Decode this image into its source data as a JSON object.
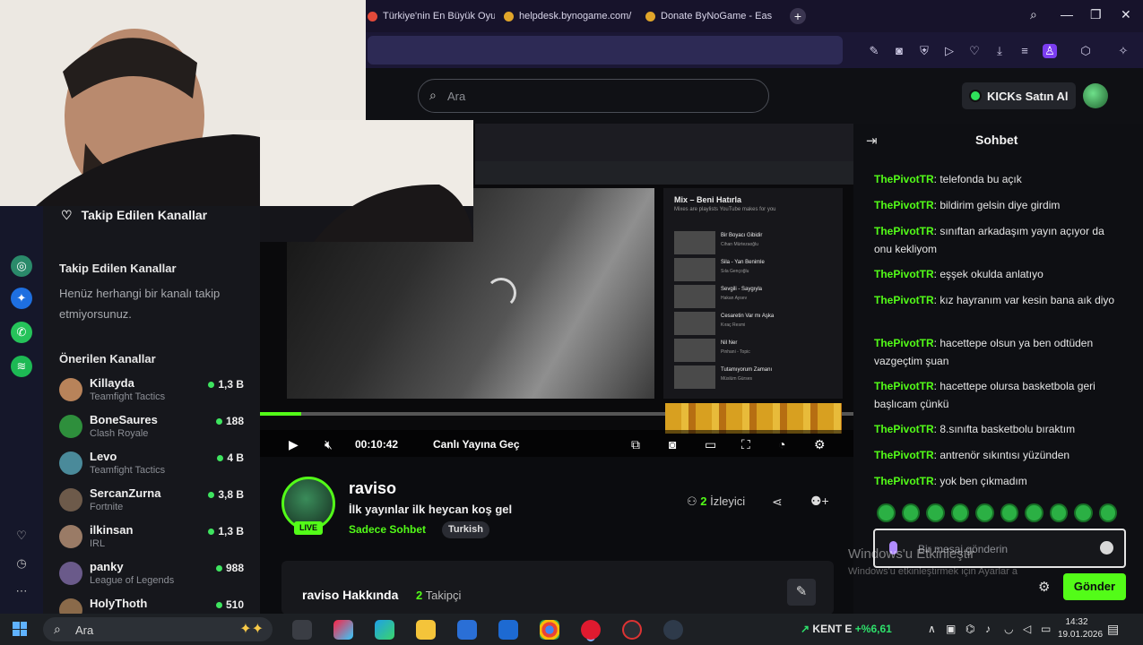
{
  "browser": {
    "tabs": [
      {
        "title": "Türkiye'nin En Büyük Oyu"
      },
      {
        "title": "helpdesk.bynogame.com/"
      },
      {
        "title": "Donate ByNoGame - Eas"
      }
    ],
    "new_tab": "+"
  },
  "kick_header": {
    "search_placeholder": "Ara",
    "kicks_button": "KICKs Satın Al"
  },
  "sidebar": {
    "followed_header": "Takip Edilen Kanallar",
    "followed_section": "Takip Edilen Kanallar",
    "followed_empty": "Henüz herhangi bir kanalı takip etmiyorsunuz.",
    "recommended_section": "Önerilen Kanallar",
    "channels": [
      {
        "name": "Killayda",
        "game": "Teamfight Tactics",
        "viewers": "1,3 B",
        "color": "#b8835a"
      },
      {
        "name": "BoneSaures",
        "game": "Clash Royale",
        "viewers": "188",
        "color": "#2e8f3c"
      },
      {
        "name": "Levo",
        "game": "Teamfight Tactics",
        "viewers": "4 B",
        "color": "#4a8a9a"
      },
      {
        "name": "SercanZurna",
        "game": "Fortnite",
        "viewers": "3,8 B",
        "color": "#6d5a4a"
      },
      {
        "name": "ilkinsan",
        "game": "IRL",
        "viewers": "1,3 B",
        "color": "#9a7b66"
      },
      {
        "name": "panky",
        "game": "League of Legends",
        "viewers": "988",
        "color": "#6a5a8a"
      },
      {
        "name": "HolyThoth",
        "game": "",
        "viewers": "510",
        "color": "#8a6a4a"
      }
    ]
  },
  "player": {
    "time": "00:10:42",
    "go_live": "Canlı Yayına Geç",
    "progress": 0.07,
    "inner_mix_title": "Mix – Beni Hatırla",
    "inner_mix_sub": "Mixes are playlists YouTube makes for you",
    "inner_mix_items": [
      {
        "title": "Bir Boyacı Gibidir",
        "artist": "Cihan Mürtezaoğlu"
      },
      {
        "title": "Sila - Yan Benimle",
        "artist": "Sıla Gençoğlu"
      },
      {
        "title": "Sevgili - Saygıyla",
        "artist": "Hakan Aysev"
      },
      {
        "title": "Cesaretin Var mı Aşka",
        "artist": "Kıraç Resmi"
      },
      {
        "title": "Nil Ner",
        "artist": "Pinhani - Topic"
      },
      {
        "title": "Tutamıyorum Zamanı",
        "artist": "Müslüm Gürses"
      }
    ]
  },
  "stream": {
    "name": "raviso",
    "title": "İlk yayınlar ilk heycan koş gel",
    "category": "Sadece Sohbet",
    "tag": "Turkish",
    "live_badge": "LIVE",
    "viewers": "2",
    "viewers_label": "İzleyici",
    "about_title": "raviso Hakkında",
    "followers": "2",
    "followers_label": "Takipçi"
  },
  "chat": {
    "title": "Sohbet",
    "messages": [
      {
        "user": "ThePivotTR",
        "text": "telefonda bu açık"
      },
      {
        "user": "ThePivotTR",
        "text": "bildirim gelsin diye girdim"
      },
      {
        "user": "ThePivotTR",
        "text": "sınıftan arkadaşım yayın açıyor da onu kekliyom"
      },
      {
        "user": "ThePivotTR",
        "text": "eşşek okulda anlatıyo"
      },
      {
        "user": "ThePivotTR",
        "text": "kız hayranım var kesin bana aık diyo"
      },
      {
        "user": "ThePivotTR",
        "text": "hacettepe olsun ya ben odtüden vazgeçtim şuan"
      },
      {
        "user": "ThePivotTR",
        "text": "hacettepe olursa basketbola geri başlıcam çünkü"
      },
      {
        "user": "ThePivotTR",
        "text": "8.sınıfta basketbolu bıraktım"
      },
      {
        "user": "ThePivotTR",
        "text": "antrenör sıkıntısı yüzünden"
      },
      {
        "user": "ThePivotTR",
        "text": "yok ben çıkmadım"
      }
    ],
    "input_placeholder": "Bir mesaj gönderin",
    "send_label": "Gönder",
    "watermark_title": "Windows'u Etkinleştir",
    "watermark_sub": "Windows'u etkinleştirmek için Ayarlar a"
  },
  "taskbar": {
    "search_placeholder": "Ara",
    "ticker_name": "KENT E",
    "ticker_change": "+%6,61",
    "time": "14:32",
    "date": "19.01.2026"
  },
  "colors": {
    "kick_green": "#53fc18",
    "browser_bg": "#17132b",
    "accent_purple": "#7b3df0"
  }
}
